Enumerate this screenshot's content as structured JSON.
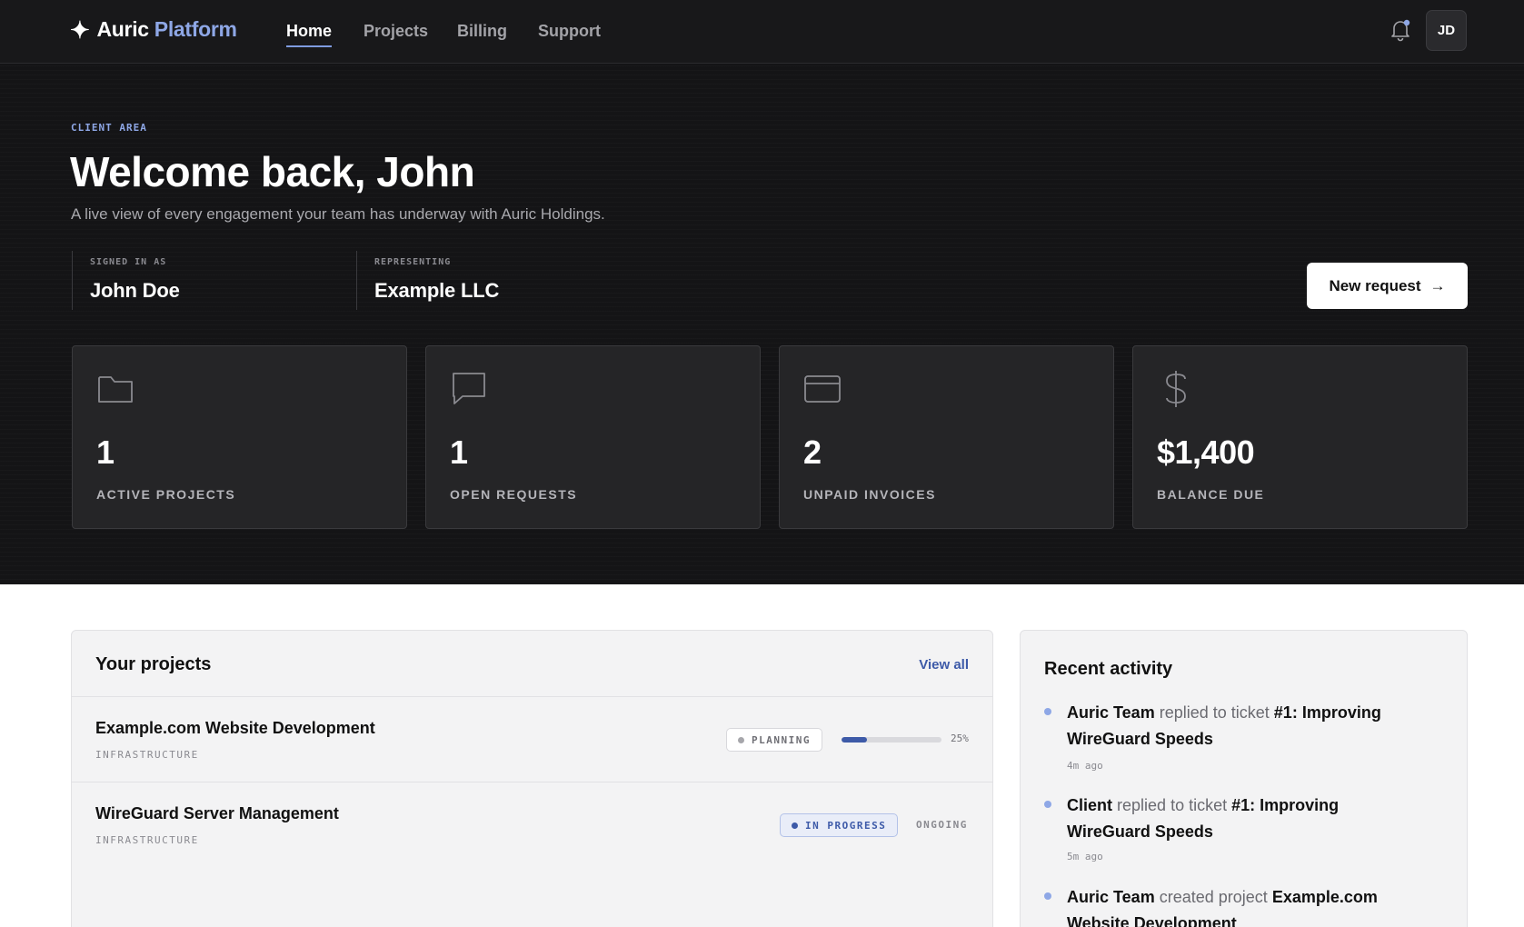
{
  "app": {
    "brand_primary": "Auric",
    "brand_secondary": "Platform",
    "brand_icon": "sparkle-icon"
  },
  "nav": {
    "items": [
      {
        "label": "Home",
        "active": true
      },
      {
        "label": "Projects",
        "active": false
      },
      {
        "label": "Billing",
        "active": false
      },
      {
        "label": "Support",
        "active": false
      }
    ]
  },
  "user": {
    "initials": "JD",
    "has_notification": true
  },
  "hero": {
    "eyebrow": "CLIENT AREA",
    "title": "Welcome back, John",
    "subtitle": "A live view of every engagement your team has underway with Auric Holdings.",
    "signed_in_label": "SIGNED IN AS",
    "signed_in_value": "John Doe",
    "representing_label": "REPRESENTING",
    "representing_value": "Example LLC",
    "new_request": "New request",
    "new_request_icon": "arrow-right-icon"
  },
  "stats": [
    {
      "value": "1",
      "label": "ACTIVE PROJECTS",
      "icon": "folder-icon"
    },
    {
      "value": "1",
      "label": "OPEN REQUESTS",
      "icon": "chat-icon"
    },
    {
      "value": "2",
      "label": "UNPAID INVOICES",
      "icon": "credit-card-icon"
    },
    {
      "value": "$1,400",
      "label": "BALANCE DUE",
      "icon": "dollar-icon"
    }
  ],
  "projects": {
    "title": "Your projects",
    "view_all": "View all",
    "items": [
      {
        "name": "Example.com Website Development",
        "category": "INFRASTRUCTURE",
        "status": "PLANNING",
        "progress": 25,
        "progress_label": "25%"
      },
      {
        "name": "WireGuard Server Management",
        "category": "INFRASTRUCTURE",
        "status": "IN PROGRESS",
        "progress_label": "ONGOING"
      }
    ]
  },
  "activity": {
    "title": "Recent activity",
    "items": [
      {
        "actor": "Auric Team",
        "action": "replied to ticket",
        "target": "#1: Improving WireGuard Speeds",
        "time": "4m ago"
      },
      {
        "actor": "Client",
        "action": "replied to ticket",
        "target": "#1: Improving WireGuard Speeds",
        "time": "5m ago"
      },
      {
        "actor": "Auric Team",
        "action": "created project",
        "target": "Example.com Website Development",
        "time": ""
      }
    ]
  },
  "colors": {
    "accent": "#3d5aa8",
    "accent_light": "#8ea7e6",
    "hero_bg": "#141416",
    "card_dark": "#252527"
  }
}
